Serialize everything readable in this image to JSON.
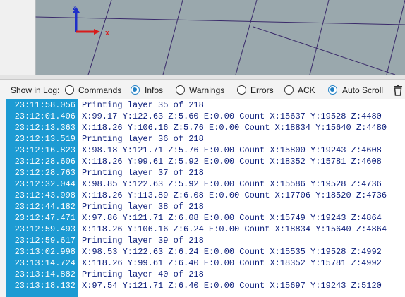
{
  "viewport": {
    "axis_z_label": "z",
    "axis_x_label": "x",
    "colors": {
      "grid": "#3a2a6a",
      "background": "#9aa8ad",
      "axis_x": "#d81b1b",
      "axis_z": "#1f2fc8"
    }
  },
  "toolbar": {
    "show_in_log_label": "Show in Log:",
    "options": [
      {
        "label": "Commands",
        "checked": false
      },
      {
        "label": "Infos",
        "checked": true
      },
      {
        "label": "Warnings",
        "checked": false
      },
      {
        "label": "Errors",
        "checked": false
      },
      {
        "label": "ACK",
        "checked": false
      },
      {
        "label": "Auto Scroll",
        "checked": true
      }
    ],
    "trash_icon": "trash-icon"
  },
  "log": {
    "entries": [
      {
        "time": "23:11:58.056",
        "message": "Printing layer 35 of 218"
      },
      {
        "time": "23:12:01.406",
        "message": "X:99.17 Y:122.63 Z:5.60 E:0.00 Count X:15637 Y:19528 Z:4480"
      },
      {
        "time": "23:12:13.363",
        "message": "X:118.26 Y:106.16 Z:5.76 E:0.00 Count X:18834 Y:15640 Z:4480"
      },
      {
        "time": "23:12:13.519",
        "message": "Printing layer 36 of 218"
      },
      {
        "time": "23:12:16.823",
        "message": "X:98.18 Y:121.71 Z:5.76 E:0.00 Count X:15800 Y:19243 Z:4608"
      },
      {
        "time": "23:12:28.606",
        "message": "X:118.26 Y:99.61 Z:5.92 E:0.00 Count X:18352 Y:15781 Z:4608"
      },
      {
        "time": "23:12:28.763",
        "message": "Printing layer 37 of 218"
      },
      {
        "time": "23:12:32.044",
        "message": "X:98.85 Y:122.63 Z:5.92 E:0.00 Count X:15586 Y:19528 Z:4736"
      },
      {
        "time": "23:12:43.998",
        "message": "X:118.26 Y:113.89 Z:6.08 E:0.00 Count X:17706 Y:18520 Z:4736"
      },
      {
        "time": "23:12:44.182",
        "message": "Printing layer 38 of 218"
      },
      {
        "time": "23:12:47.471",
        "message": "X:97.86 Y:121.71 Z:6.08 E:0.00 Count X:15749 Y:19243 Z:4864"
      },
      {
        "time": "23:12:59.493",
        "message": "X:118.26 Y:106.16 Z:6.24 E:0.00 Count X:18834 Y:15640 Z:4864"
      },
      {
        "time": "23:12:59.617",
        "message": "Printing layer 39 of 218"
      },
      {
        "time": "23:13:02.998",
        "message": "X:98.53 Y:122.63 Z:6.24 E:0.00 Count X:15535 Y:19528 Z:4992"
      },
      {
        "time": "23:13:14.724",
        "message": "X:118.26 Y:99.61 Z:6.40 E:0.00 Count X:18352 Y:15781 Z:4992"
      },
      {
        "time": "23:13:14.882",
        "message": "Printing layer 40 of 218"
      },
      {
        "time": "23:13:18.132",
        "message": "X:97.54 Y:121.71 Z:6.40 E:0.00 Count X:15697 Y:19243 Z:5120"
      }
    ],
    "colors": {
      "time_bg": "#1d9bd3",
      "time_fg": "#ffffff",
      "message_fg": "#0a1c7a"
    }
  }
}
